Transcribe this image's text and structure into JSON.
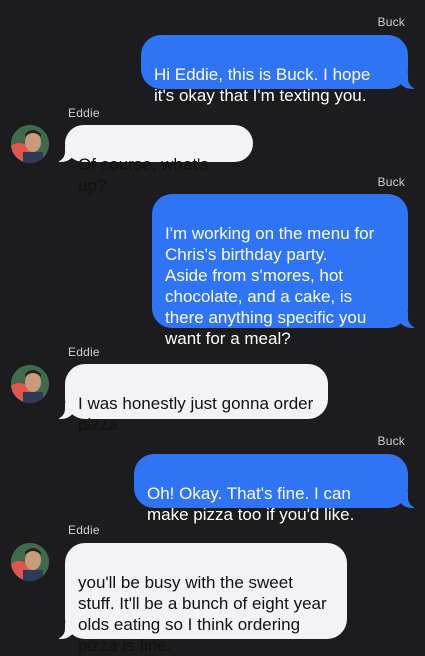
{
  "conversation": {
    "messages": [
      {
        "sender": "Buck",
        "direction": "outgoing",
        "text": "Hi Eddie, this is Buck. I hope it's okay that I'm texting you."
      },
      {
        "sender": "Eddie",
        "direction": "incoming",
        "text": "Of course, what's up?"
      },
      {
        "sender": "Buck",
        "direction": "outgoing",
        "text": "I'm working on the menu for Chris's birthday party.\nAside from s'mores, hot chocolate, and a cake, is there anything specific you want for a meal?"
      },
      {
        "sender": "Eddie",
        "direction": "incoming",
        "text": "I was honestly just gonna order pizza."
      },
      {
        "sender": "Buck",
        "direction": "outgoing",
        "text": "Oh! Okay. That's fine. I can make pizza too if you'd like."
      },
      {
        "sender": "Eddie",
        "direction": "incoming",
        "text": "you'll be busy with the sweet stuff. It'll be a bunch of eight year olds eating so I think ordering pizza is fine."
      }
    ]
  },
  "theme": {
    "background": "#1c1c1e",
    "outgoing_bubble": "#2f74f5",
    "incoming_bubble": "#f3f3f7",
    "avatar_icon": "contact-photo-icon"
  }
}
